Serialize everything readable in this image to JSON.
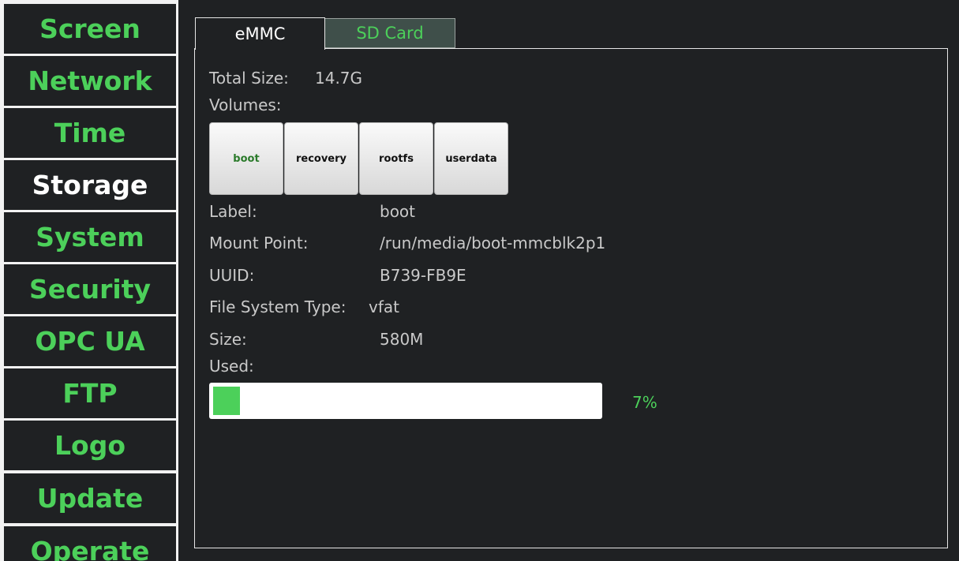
{
  "sidebar": {
    "items": [
      {
        "label": "Screen"
      },
      {
        "label": "Network"
      },
      {
        "label": "Time"
      },
      {
        "label": "Storage"
      },
      {
        "label": "System"
      },
      {
        "label": "Security"
      },
      {
        "label": "OPC UA"
      },
      {
        "label": "FTP"
      },
      {
        "label": "Logo"
      },
      {
        "label": "Update"
      },
      {
        "label": "Operate"
      }
    ],
    "active_label": "Storage"
  },
  "tabs": [
    {
      "label": "eMMC",
      "selected": true
    },
    {
      "label": "SD Card",
      "selected": false
    }
  ],
  "storage": {
    "total_size_label": "Total Size:",
    "total_size_value": "14.7G",
    "volumes_label": "Volumes:",
    "volumes": [
      "boot",
      "recovery",
      "rootfs",
      "userdata"
    ],
    "selected_volume": "boot",
    "details": {
      "label_key": "Label:",
      "label_value": "boot",
      "mount_key": "Mount Point:",
      "mount_value": "/run/media/boot-mmcblk2p1",
      "uuid_key": "UUID:",
      "uuid_value": "B739-FB9E",
      "fs_key": "File System Type:",
      "fs_value": "vfat",
      "size_key": "Size:",
      "size_value": "580M",
      "used_key": "Used:"
    },
    "used_percent": 7,
    "used_percent_text": "7%"
  },
  "colors": {
    "accent_green": "#4cd05a",
    "background": "#1f2123",
    "active_text": "#ffffff"
  }
}
